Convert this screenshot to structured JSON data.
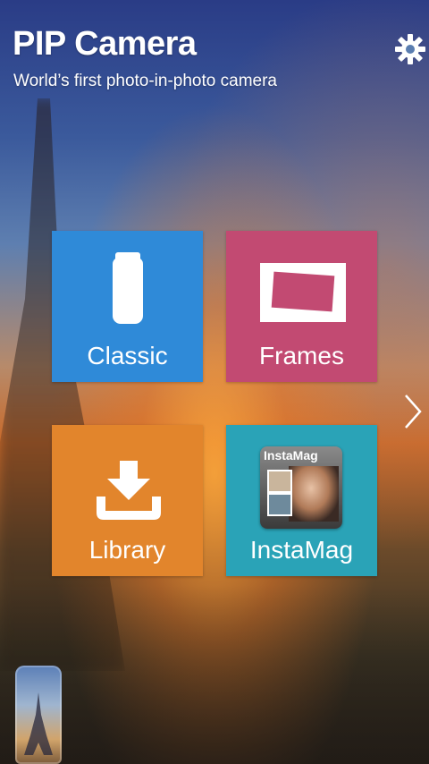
{
  "header": {
    "title": "PIP Camera",
    "subtitle": "World’s first photo-in-photo camera"
  },
  "tiles": [
    {
      "label": "Classic",
      "icon": "bottle-icon",
      "color": "#2f8ad8"
    },
    {
      "label": "Frames",
      "icon": "frame-icon",
      "color": "#c24a72"
    },
    {
      "label": "Library",
      "icon": "download-icon",
      "color": "#e2852c"
    },
    {
      "label": "InstaMag",
      "icon": "instamag-thumbnail",
      "color": "#2aa3b7",
      "thumbnail_text": "InstaMag"
    }
  ],
  "icons": {
    "settings": "gear-icon",
    "next": "chevron-right-icon",
    "preview": "bottle-preview-thumbnail"
  }
}
